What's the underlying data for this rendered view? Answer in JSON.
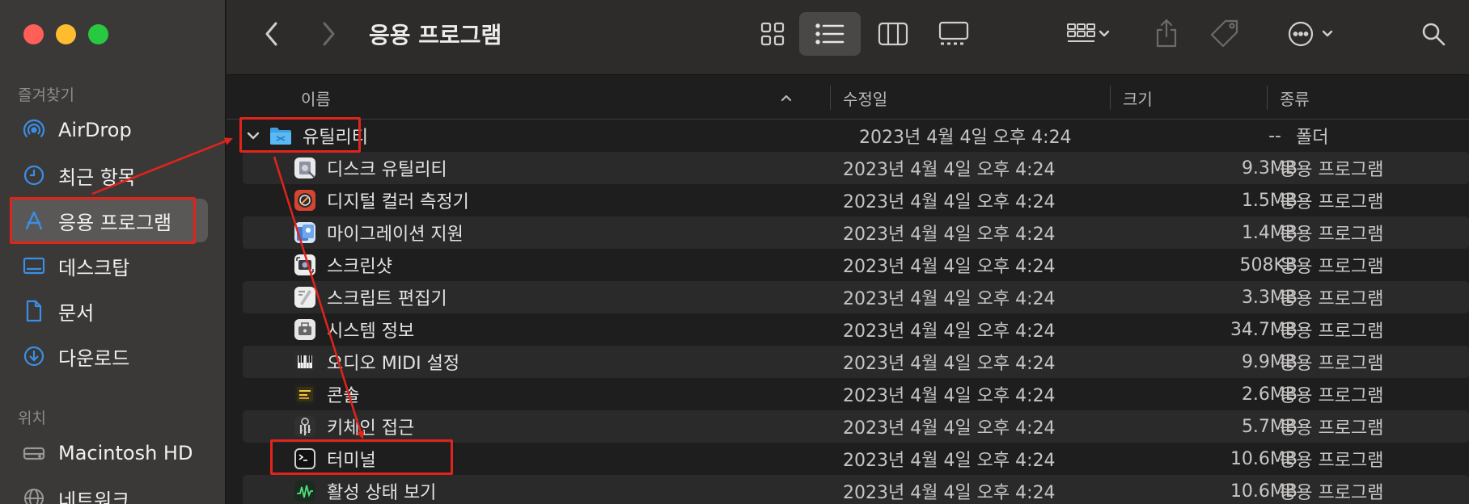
{
  "sidebar": {
    "favorites_title": "즐겨찾기",
    "favorites": [
      {
        "label": "AirDrop",
        "icon": "airdrop-icon"
      },
      {
        "label": "최근 항목",
        "icon": "clock-icon"
      },
      {
        "label": "응용 프로그램",
        "icon": "applications-icon"
      },
      {
        "label": "데스크탑",
        "icon": "desktop-icon"
      },
      {
        "label": "문서",
        "icon": "document-icon"
      },
      {
        "label": "다운로드",
        "icon": "download-icon"
      }
    ],
    "locations_title": "위치",
    "locations": [
      {
        "label": "Macintosh HD",
        "icon": "harddisk-icon"
      },
      {
        "label": "네트워크",
        "icon": "network-icon"
      }
    ]
  },
  "toolbar": {
    "title": "응용 프로그램",
    "view_mode": "list"
  },
  "columns": {
    "name": "이름",
    "modified": "수정일",
    "size": "크기",
    "kind": "종류"
  },
  "folder": {
    "name": "유틸리티",
    "modified": "2023년 4월 4일 오후 4:24",
    "size": "--",
    "kind": "폴더"
  },
  "items": [
    {
      "name": "디스크 유틸리티",
      "modified": "2023년 4월 4일 오후 4:24",
      "size": "9.3MB",
      "kind": "응용 프로그램",
      "icon": "disk-utility-icon"
    },
    {
      "name": "디지털 컬러 측정기",
      "modified": "2023년 4월 4일 오후 4:24",
      "size": "1.5MB",
      "kind": "응용 프로그램",
      "icon": "color-meter-icon"
    },
    {
      "name": "마이그레이션 지원",
      "modified": "2023년 4월 4일 오후 4:24",
      "size": "1.4MB",
      "kind": "응용 프로그램",
      "icon": "migration-assistant-icon"
    },
    {
      "name": "스크린샷",
      "modified": "2023년 4월 4일 오후 4:24",
      "size": "508KB",
      "kind": "응용 프로그램",
      "icon": "screenshot-icon"
    },
    {
      "name": "스크립트 편집기",
      "modified": "2023년 4월 4일 오후 4:24",
      "size": "3.3MB",
      "kind": "응용 프로그램",
      "icon": "script-editor-icon"
    },
    {
      "name": "시스템 정보",
      "modified": "2023년 4월 4일 오후 4:24",
      "size": "34.7MB",
      "kind": "응용 프로그램",
      "icon": "system-information-icon"
    },
    {
      "name": "오디오 MIDI 설정",
      "modified": "2023년 4월 4일 오후 4:24",
      "size": "9.9MB",
      "kind": "응용 프로그램",
      "icon": "audio-midi-icon"
    },
    {
      "name": "콘솔",
      "modified": "2023년 4월 4일 오후 4:24",
      "size": "2.6MB",
      "kind": "응용 프로그램",
      "icon": "console-icon"
    },
    {
      "name": "키체인 접근",
      "modified": "2023년 4월 4일 오후 4:24",
      "size": "5.7MB",
      "kind": "응용 프로그램",
      "icon": "keychain-icon"
    },
    {
      "name": "터미널",
      "modified": "2023년 4월 4일 오후 4:24",
      "size": "10.6MB",
      "kind": "응용 프로그램",
      "icon": "terminal-icon"
    },
    {
      "name": "활성 상태 보기",
      "modified": "2023년 4월 4일 오후 4:24",
      "size": "10.6MB",
      "kind": "응용 프로그램",
      "icon": "activity-monitor-icon"
    }
  ],
  "colors": {
    "annotation": "#e0241b",
    "accent": "#3a8ee6"
  }
}
